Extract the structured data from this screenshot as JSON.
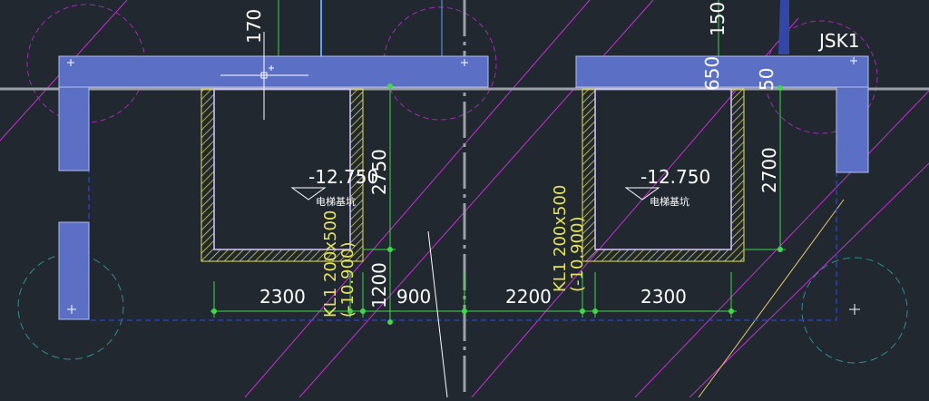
{
  "colors": {
    "background": "#212830",
    "selection_fill": "#5b6fc4",
    "selection_stroke": "#b3bdf2",
    "wall_hatch": "#e5e35a",
    "dimension": "#3fd94a",
    "layer_magenta": "#c72fd6",
    "layer_cyan": "#3cb6b8",
    "dashed_outline": "#2b45d9",
    "crosshair": "#ffffff",
    "axis_gray": "#9aa0a6"
  },
  "labels": {
    "tag": "JSK1",
    "elev_left": "-12.750",
    "elev_right": "-12.750",
    "pit_left": "电梯基坑",
    "pit_right": "电梯基坑",
    "beam_left_line1": "KL1 200x500",
    "beam_left_line2": "(-10.900)",
    "beam_right_line1": "KL1 200x500",
    "beam_right_line2": "(-10.900)"
  },
  "dims": {
    "top_left_partial": "170",
    "top_right_partial": "150",
    "mid_right_partial_a": "650",
    "mid_right_partial_b": "50",
    "height_left": "2750",
    "height_right": "2700",
    "depth_left": "1200",
    "horiz_1": "2300",
    "horiz_2": "900",
    "horiz_3": "2200",
    "horiz_4": "2300"
  }
}
